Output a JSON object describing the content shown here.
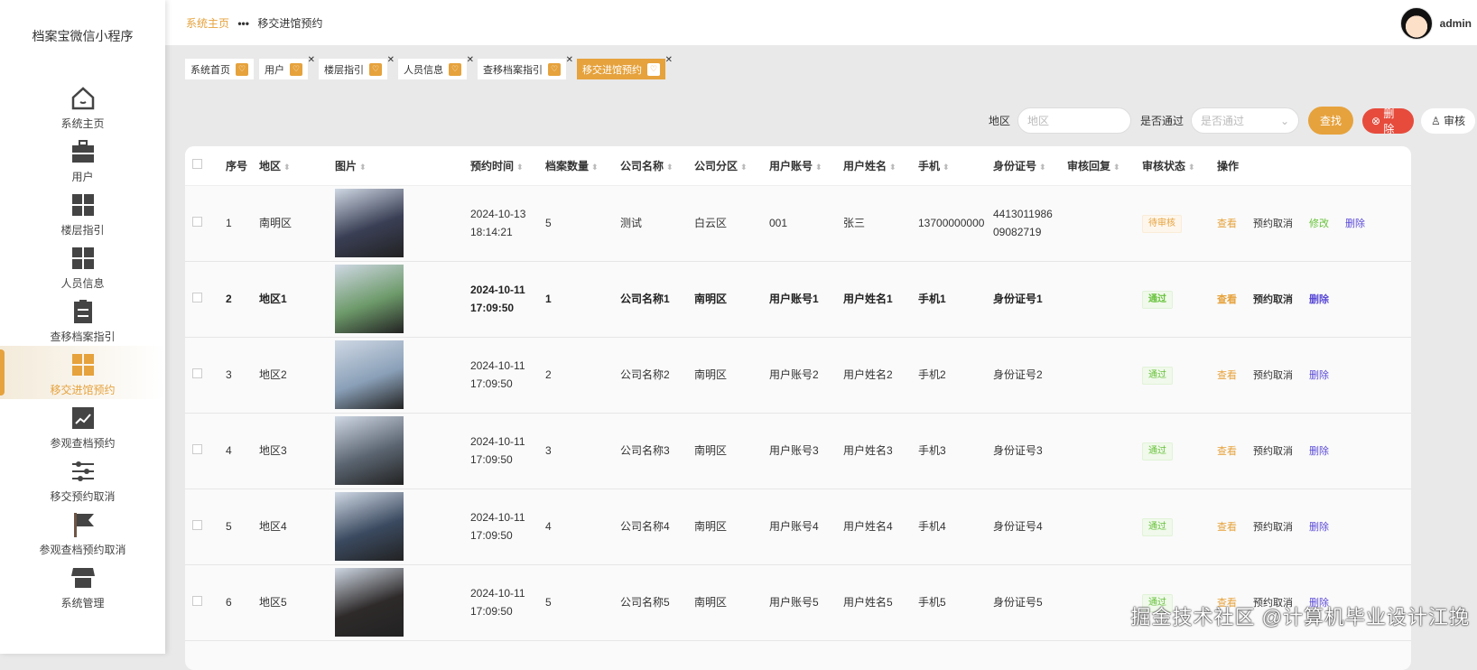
{
  "app": {
    "title": "档案宝微信小程序"
  },
  "sidebar": {
    "items": [
      {
        "label": "系统主页",
        "icon": "home-icon"
      },
      {
        "label": "用户",
        "icon": "briefcase-icon"
      },
      {
        "label": "楼层指引",
        "icon": "grid-icon"
      },
      {
        "label": "人员信息",
        "icon": "grid-icon"
      },
      {
        "label": "查移档案指引",
        "icon": "clipboard-icon"
      },
      {
        "label": "移交进馆预约",
        "icon": "grid-icon",
        "active": true
      },
      {
        "label": "参观查档预约",
        "icon": "chart-icon"
      },
      {
        "label": "移交预约取消",
        "icon": "sliders-icon"
      },
      {
        "label": "参观查档预约取消",
        "icon": "flag-icon"
      },
      {
        "label": "系统管理",
        "icon": "shop-icon"
      }
    ]
  },
  "breadcrumb": {
    "home": "系统主页",
    "sep": "•••",
    "current": "移交进馆预约"
  },
  "user": {
    "name": "admin"
  },
  "tags": [
    {
      "label": "系统首页"
    },
    {
      "label": "用户"
    },
    {
      "label": "楼层指引"
    },
    {
      "label": "人员信息"
    },
    {
      "label": "查移档案指引"
    },
    {
      "label": "移交进馆预约"
    }
  ],
  "search": {
    "region_label": "地区",
    "region_placeholder": "地区",
    "pass_label": "是否通过",
    "pass_placeholder": "是否通过",
    "find": "查找",
    "delete": "删除",
    "audit": "审核"
  },
  "table": {
    "headers": [
      "序号",
      "地区",
      "图片",
      "预约时间",
      "档案数量",
      "公司名称",
      "公司分区",
      "用户账号",
      "用户姓名",
      "手机",
      "身份证号",
      "审核回复",
      "审核状态",
      "操作"
    ],
    "actions": {
      "view": "查看",
      "cancel": "预约取消",
      "edit": "修改",
      "delete": "删除"
    },
    "rows": [
      {
        "no": "1",
        "region": "南明区",
        "time": "2024-10-13 18:14:21",
        "count": "5",
        "company": "测试",
        "district": "白云区",
        "account": "001",
        "name": "张三",
        "phone": "13700000000",
        "id": "441301198609082719",
        "reply": "",
        "status": "待审核",
        "image_color": "#3a3f55"
      },
      {
        "no": "2",
        "region": "地区1",
        "time": "2024-10-11 17:09:50",
        "count": "1",
        "company": "公司名称1",
        "district": "南明区",
        "account": "用户账号1",
        "name": "用户姓名1",
        "phone": "手机1",
        "id": "身份证号1",
        "reply": "",
        "status": "通过",
        "image_color": "#6d9a6a"
      },
      {
        "no": "3",
        "region": "地区2",
        "time": "2024-10-11 17:09:50",
        "count": "2",
        "company": "公司名称2",
        "district": "南明区",
        "account": "用户账号2",
        "name": "用户姓名2",
        "phone": "手机2",
        "id": "身份证号2",
        "reply": "",
        "status": "通过",
        "image_color": "#8aa0b8"
      },
      {
        "no": "4",
        "region": "地区3",
        "time": "2024-10-11 17:09:50",
        "count": "3",
        "company": "公司名称3",
        "district": "南明区",
        "account": "用户账号3",
        "name": "用户姓名3",
        "phone": "手机3",
        "id": "身份证号3",
        "reply": "",
        "status": "通过",
        "image_color": "#5a6470"
      },
      {
        "no": "5",
        "region": "地区4",
        "time": "2024-10-11 17:09:50",
        "count": "4",
        "company": "公司名称4",
        "district": "南明区",
        "account": "用户账号4",
        "name": "用户姓名4",
        "phone": "手机4",
        "id": "身份证号4",
        "reply": "",
        "status": "通过",
        "image_color": "#3b4a60"
      },
      {
        "no": "6",
        "region": "地区5",
        "time": "2024-10-11 17:09:50",
        "count": "5",
        "company": "公司名称5",
        "district": "南明区",
        "account": "用户账号5",
        "name": "用户姓名5",
        "phone": "手机5",
        "id": "身份证号5",
        "reply": "",
        "status": "通过",
        "image_color": "#2e2a2a"
      }
    ]
  },
  "watermark": "掘金技术社区 @计算机毕业设计江挽"
}
